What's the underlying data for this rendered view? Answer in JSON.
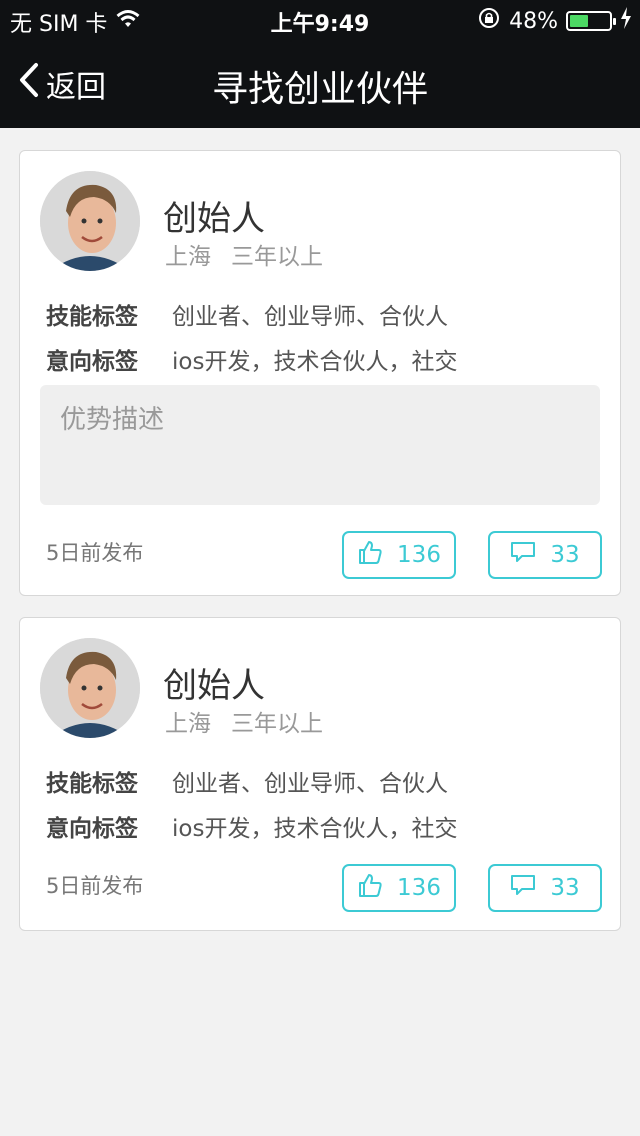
{
  "status_bar": {
    "carrier": "无 SIM 卡",
    "time": "上午9:49",
    "battery": "48%",
    "battery_level": 0.48
  },
  "nav": {
    "back_label": "返回",
    "title": "寻找创业伙伴"
  },
  "cards": [
    {
      "name": "创始人",
      "city": "上海",
      "experience": "三年以上",
      "skill_label": "技能标签",
      "skill_value": "创业者、创业导师、合伙人",
      "intent_label": "意向标签",
      "intent_value": "ios开发，技术合伙人，社交",
      "description_placeholder": "优势描述",
      "posted": "5日前发布",
      "likes": "136",
      "comments": "33"
    },
    {
      "name": "创始人",
      "city": "上海",
      "experience": "三年以上",
      "skill_label": "技能标签",
      "skill_value": "创业者、创业导师、合伙人",
      "intent_label": "意向标签",
      "intent_value": "ios开发，技术合伙人，社交",
      "posted": "5日前发布",
      "likes": "136",
      "comments": "33"
    }
  ],
  "colors": {
    "accent": "#3ccad4",
    "header_bg": "#0f1113",
    "page_bg": "#f2f2f2"
  },
  "icons": {
    "like": "thumbs-up-icon",
    "comment": "speech-bubble-icon",
    "back": "chevron-left-icon"
  }
}
